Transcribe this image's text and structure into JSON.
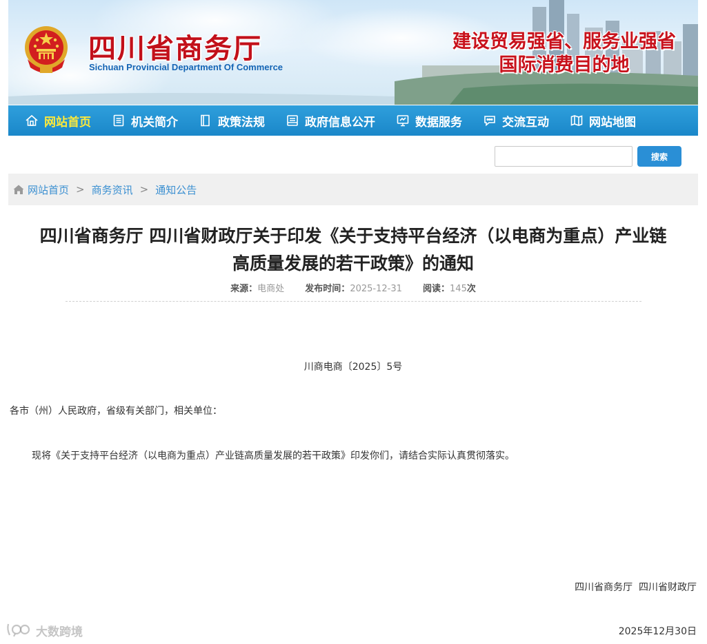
{
  "header": {
    "site_title": "四川省商务厅",
    "site_subtitle": "Sichuan Provincial Department Of Commerce",
    "slogan_line1": "建设贸易强省、服务业强省",
    "slogan_line2": "国际消费目的地"
  },
  "nav": {
    "items": [
      {
        "label": "网站首页",
        "icon": "home-icon",
        "active": true
      },
      {
        "label": "机关简介",
        "icon": "document-icon"
      },
      {
        "label": "政策法规",
        "icon": "book-icon"
      },
      {
        "label": "政府信息公开",
        "icon": "folder-icon"
      },
      {
        "label": "数据服务",
        "icon": "monitor-icon"
      },
      {
        "label": "交流互动",
        "icon": "chat-icon"
      },
      {
        "label": "网站地图",
        "icon": "map-icon"
      }
    ]
  },
  "search": {
    "value": "",
    "button_label": "搜索"
  },
  "breadcrumb": {
    "items": [
      "网站首页",
      "商务资讯",
      "通知公告"
    ],
    "separator": ">"
  },
  "article": {
    "title_line1": "四川省商务厅 四川省财政厅关于印发《关于支持平台经济（以电商为重点）产业链",
    "title_line2": "高质量发展的若干政策》的通知",
    "source_label": "来源：",
    "source": "电商处",
    "date_label": "发布时间：",
    "date": "2025-12-31",
    "views_label": "阅读：",
    "views": "145",
    "views_unit": "次",
    "doc_number": "川商电商〔2025〕5号",
    "salutation": "各市（州）人民政府，省级有关部门，相关单位：",
    "body": "现将《关于支持平台经济（以电商为重点）产业链高质量发展的若干政策》印发你们，请结合实际认真贯彻落实。",
    "signature": "四川省商务厅  四川省财政厅",
    "sign_date": "2025年12月30日"
  },
  "watermark": {
    "text": "大数跨境"
  },
  "colors": {
    "nav_bg": "#1a87c9",
    "nav_active": "#ffea3a",
    "title_red": "#c2101a",
    "link_blue": "#3a8fd1",
    "search_button": "#2a8fd6"
  }
}
